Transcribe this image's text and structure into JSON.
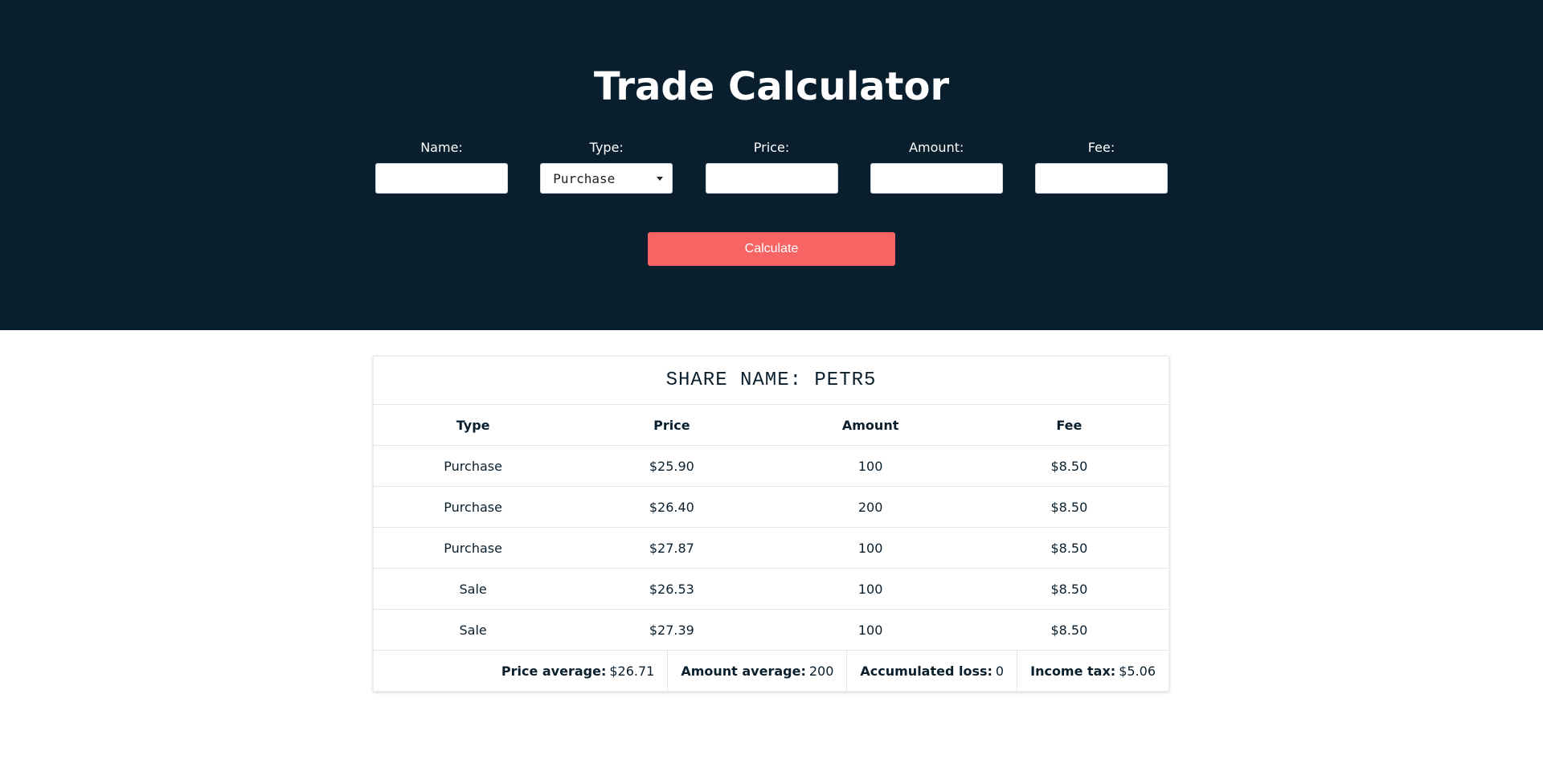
{
  "header": {
    "title": "Trade Calculator",
    "fields": {
      "name": {
        "label": "Name:",
        "value": ""
      },
      "type": {
        "label": "Type:",
        "value": "Purchase"
      },
      "price": {
        "label": "Price:",
        "value": ""
      },
      "amount": {
        "label": "Amount:",
        "value": ""
      },
      "fee": {
        "label": "Fee:",
        "value": ""
      }
    },
    "calculate_label": "Calculate"
  },
  "colors": {
    "header_bg": "#091f2e",
    "button": "#f66464"
  },
  "result": {
    "share_name": "SHARE NAME: PETR5",
    "columns": [
      "Type",
      "Price",
      "Amount",
      "Fee"
    ],
    "rows": [
      [
        "Purchase",
        "$25.90",
        "100",
        "$8.50"
      ],
      [
        "Purchase",
        "$26.40",
        "200",
        "$8.50"
      ],
      [
        "Purchase",
        "$27.87",
        "100",
        "$8.50"
      ],
      [
        "Sale",
        "$26.53",
        "100",
        "$8.50"
      ],
      [
        "Sale",
        "$27.39",
        "100",
        "$8.50"
      ]
    ],
    "summary": {
      "price_average_label": "Price average:",
      "price_average": "$26.71",
      "amount_average_label": "Amount average:",
      "amount_average": "200",
      "accumulated_loss_label": "Accumulated loss:",
      "accumulated_loss": "0",
      "income_tax_label": "Income tax:",
      "income_tax": "$5.06"
    }
  }
}
